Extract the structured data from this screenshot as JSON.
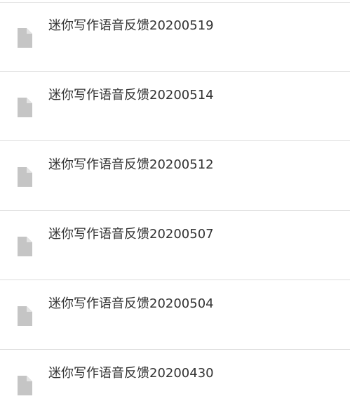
{
  "colors": {
    "divider": "#dcdcdc",
    "file_icon": "#c5c5c5",
    "file_name_text": "#333333",
    "background": "#ffffff"
  },
  "file_list": {
    "items": [
      {
        "name": "迷你写作语音反馈20200519",
        "icon": "document-icon"
      },
      {
        "name": "迷你写作语音反馈20200514",
        "icon": "document-icon"
      },
      {
        "name": "迷你写作语音反馈20200512",
        "icon": "document-icon"
      },
      {
        "name": "迷你写作语音反馈20200507",
        "icon": "document-icon"
      },
      {
        "name": "迷你写作语音反馈20200504",
        "icon": "document-icon"
      },
      {
        "name": "迷你写作语音反馈20200430",
        "icon": "document-icon"
      }
    ]
  }
}
